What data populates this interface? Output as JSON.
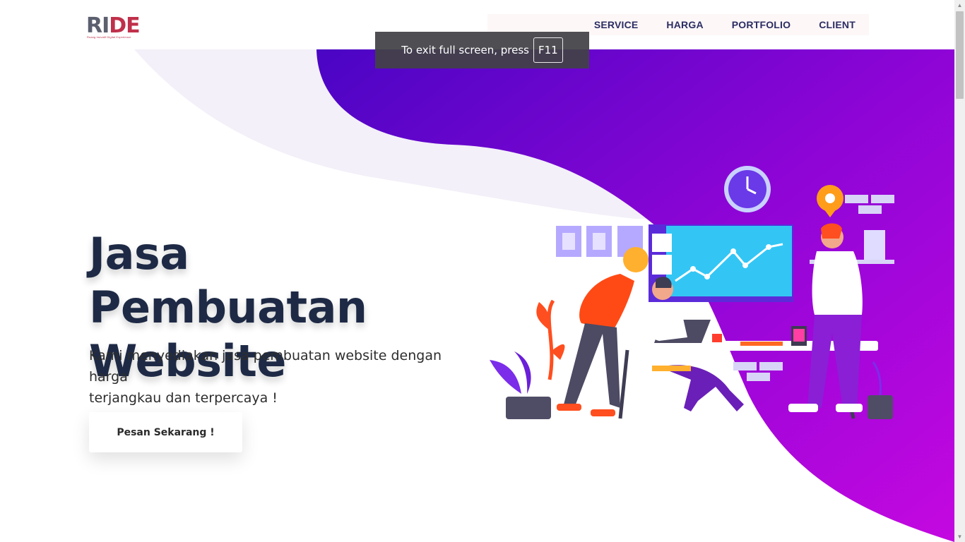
{
  "logo": {
    "text_main": "RI",
    "text_accent": "DE",
    "tagline": "Ruang Inovatif Digital Experience"
  },
  "nav": {
    "items": [
      "SERVICE",
      "HARGA",
      "PORTFOLIO",
      "CLIENT"
    ]
  },
  "fullscreen_notice": {
    "text": "To exit full screen, press",
    "key": "F11"
  },
  "hero": {
    "title_line1": "Jasa Pembuatan",
    "title_line2": "Website",
    "subtitle_line1": "Kami menyediakan jasa pembuatan website dengan harga",
    "subtitle_line2": "terjangkau dan terpercaya !",
    "cta_label": "Pesan Sekarang !"
  },
  "colors": {
    "title": "#1e2a45",
    "nav_text": "#2b2d63",
    "gradient_start": "#5a00c8",
    "gradient_end": "#c200e0",
    "logo_accent": "#c0304a"
  },
  "icons": {
    "illustration": "team-working-illustration",
    "scroll_up": "scroll-up-arrow-icon",
    "scroll_down": "scroll-down-arrow-icon"
  }
}
